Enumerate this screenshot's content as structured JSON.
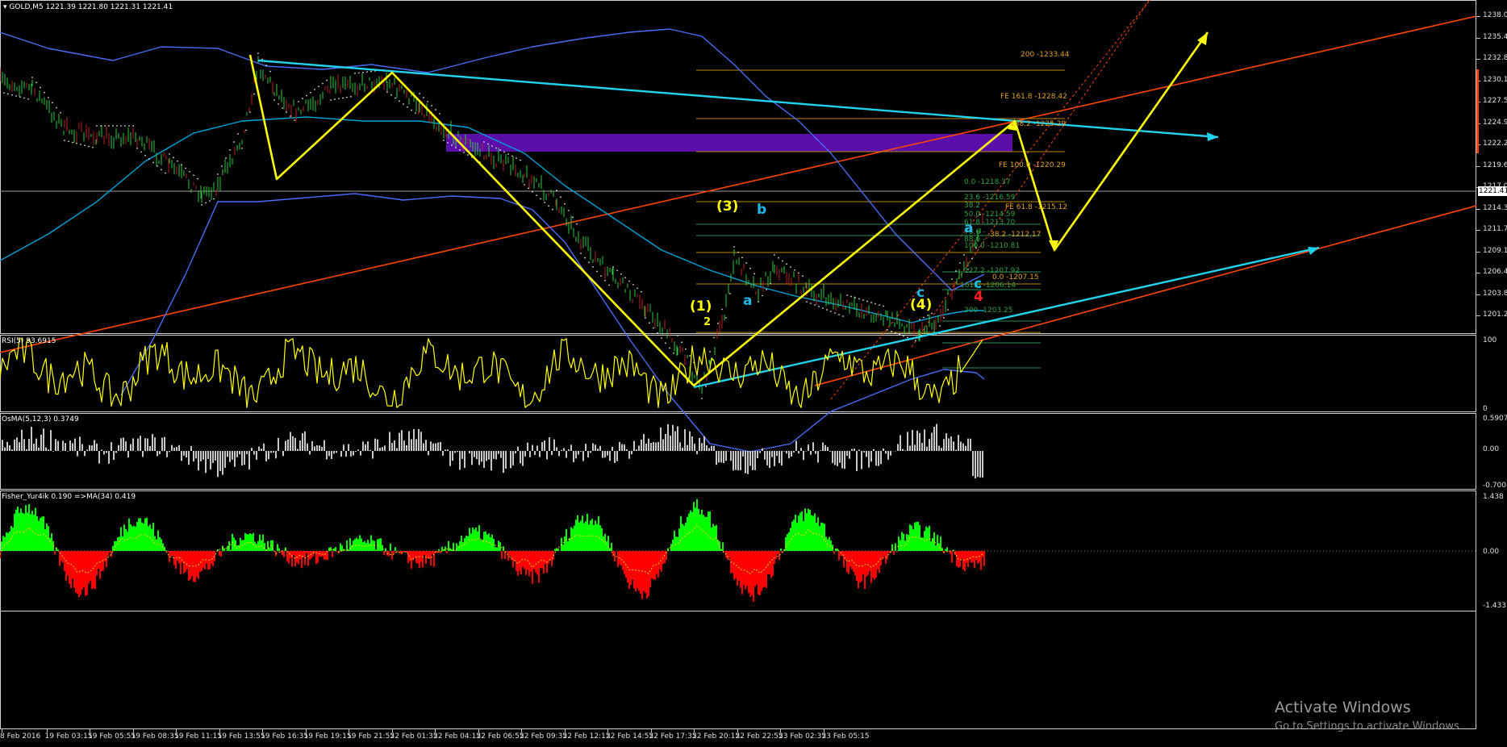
{
  "header": {
    "symbol": "GOLD,M5",
    "ohlc": "1221.39 1221.80 1221.31 1221.41"
  },
  "price_axis": {
    "labels": [
      "1238.09",
      "1235.44",
      "1232.84",
      "1230.19",
      "1227.54",
      "1224.94",
      "1222.29",
      "1219.64",
      "1217.04",
      "1214.39",
      "1211.74",
      "1209.14",
      "1206.49",
      "1203.84",
      "1201.24"
    ],
    "current": "1221.41"
  },
  "rsi_panel": {
    "label": "RSI(5) 93.6915",
    "levels": [
      "100",
      "0"
    ]
  },
  "osma_panel": {
    "label": "OsMA(5,12,3) 0.3749",
    "levels": [
      "0.5907",
      "0.00",
      "-0.7008"
    ]
  },
  "fisher_panel": {
    "label": "Fisher_Yur4ik 0.190  =>MA(34) 0.419",
    "levels": [
      "1.438",
      "0.00",
      "-1.433"
    ]
  },
  "time_axis": [
    "8 Feb 2016",
    "19 Feb 03:15",
    "19 Feb 05:55",
    "19 Feb 08:35",
    "19 Feb 11:15",
    "19 Feb 13:55",
    "19 Feb 16:35",
    "19 Feb 19:15",
    "19 Feb 21:55",
    "22 Feb 01:35",
    "22 Feb 04:15",
    "22 Feb 06:55",
    "22 Feb 09:35",
    "22 Feb 12:15",
    "22 Feb 14:55",
    "22 Feb 17:35",
    "22 Feb 20:15",
    "22 Feb 22:55",
    "23 Feb 02:35",
    "23 Feb 05:15"
  ],
  "fib_labels": {
    "f200": "200 -1233.44",
    "fe1618": "FE 161.8 -1228.42",
    "f1382": "138.2 -1225.29",
    "fe100": "FE 100.0 -1220.29",
    "f00a": "0.0 -1218.37",
    "f236": "23.6 -1216.59",
    "f382a": "38.2",
    "fe618": "FE 61.8 -1215.12",
    "f500": "50.0 -1214.59",
    "f618": "61.8 -1213.70",
    "f786": "78.6 -",
    "f382b": "38.2 -1212.17",
    "f886": "88.6 -",
    "f1000": "100.0 -1210.81",
    "f1272": "127.2 -1207.92",
    "f00b": "0.0 -1207.15",
    "f1618": "161.8 -1206.14",
    "f200b": "200 -1203.25"
  },
  "wave_labels": {
    "w1": "(1)",
    "w2": "2",
    "w3": "(3)",
    "w4": "(4)",
    "b": "b",
    "a1": "a",
    "a2": "a",
    "c1": "c",
    "c2": "c",
    "four": "4"
  },
  "colors": {
    "yellow": "#ffff00",
    "cyan": "#22d3ee",
    "orange": "#ff4500",
    "blue": "#4a6cf7",
    "purple": "#5b0ea8",
    "green": "#00ff00",
    "red": "#ff0000"
  },
  "watermark": {
    "title": "Activate Windows",
    "subtitle": "Go to Settings to activate Windows."
  }
}
